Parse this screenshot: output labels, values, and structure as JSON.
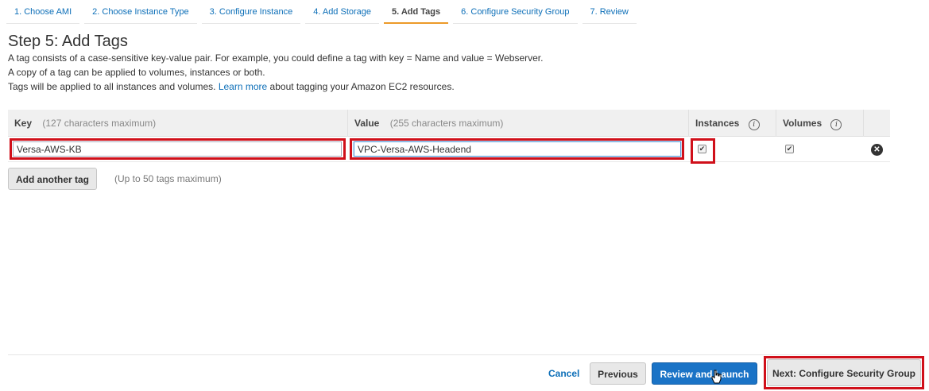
{
  "wizard": {
    "steps": [
      {
        "label": "1. Choose AMI"
      },
      {
        "label": "2. Choose Instance Type"
      },
      {
        "label": "3. Configure Instance"
      },
      {
        "label": "4. Add Storage"
      },
      {
        "label": "5. Add Tags"
      },
      {
        "label": "6. Configure Security Group"
      },
      {
        "label": "7. Review"
      }
    ],
    "active_step": 4
  },
  "page": {
    "title": "Step 5: Add Tags",
    "desc1": "A tag consists of a case-sensitive key-value pair. For example, you could define a tag with key = Name and value = Webserver.",
    "desc2": "A copy of a tag can be applied to volumes, instances or both.",
    "desc3_pre": "Tags will be applied to all instances and volumes.",
    "learn_more": "Learn more",
    "desc3_post": "about tagging your Amazon EC2 resources."
  },
  "table": {
    "headers": {
      "key": "Key",
      "key_hint": "(127 characters maximum)",
      "value": "Value",
      "value_hint": "(255 characters maximum)",
      "instances": "Instances",
      "volumes": "Volumes",
      "info_glyph": "i"
    },
    "rows": [
      {
        "key": "Versa-AWS-KB",
        "value": "VPC-Versa-AWS-Headend",
        "instances": true,
        "volumes": true
      }
    ],
    "remove_glyph": "✕"
  },
  "actions": {
    "add_tag": "Add another tag",
    "add_tag_note": "(Up to 50 tags maximum)",
    "cancel": "Cancel",
    "previous": "Previous",
    "review_launch": "Review and Launch",
    "next": "Next: Configure Security Group"
  },
  "colors": {
    "link": "#0d6fb8",
    "primary_button": "#1a73c6",
    "highlight_box": "#d0101a",
    "active_step_underline": "#ec9a29"
  },
  "icons": {
    "info": "info-circle-icon",
    "remove": "remove-circle-icon",
    "cursor": "hand-pointer-cursor-icon"
  }
}
